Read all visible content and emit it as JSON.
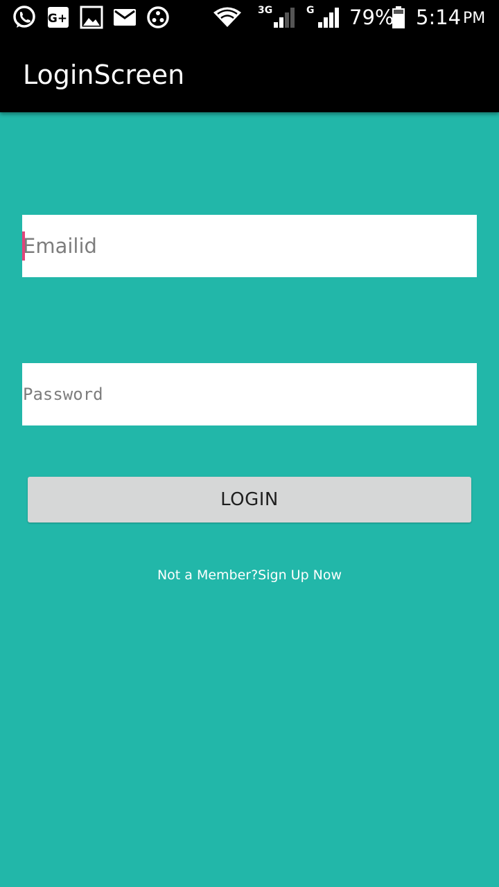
{
  "status_bar": {
    "icons": [
      "whatsapp-icon",
      "google-plus-icon",
      "gallery-icon",
      "mail-icon",
      "app-icon",
      "wifi-icon",
      "3g-signal-icon",
      "g-signal-icon",
      "battery-icon"
    ],
    "net_3g": "3G",
    "net_g": "G",
    "battery": "79%",
    "time": "5:14",
    "ampm": "PM"
  },
  "app_bar": {
    "title": "LoginScreen"
  },
  "form": {
    "email_placeholder": "Emailid",
    "email_value": "",
    "password_placeholder": "Password",
    "password_value": "",
    "login_label": "LOGIN",
    "signup_text": "Not a Member?Sign Up Now"
  },
  "colors": {
    "background": "#22b7a9",
    "app_bar": "#000000",
    "button": "#d6d7d7",
    "caret": "#e0457b"
  }
}
